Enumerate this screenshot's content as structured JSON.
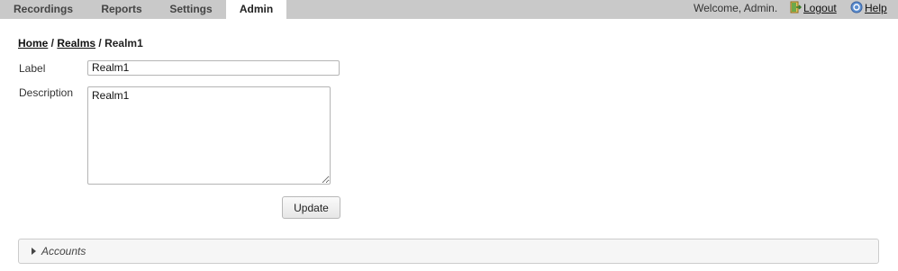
{
  "nav": {
    "tabs": [
      {
        "label": "Recordings"
      },
      {
        "label": "Reports"
      },
      {
        "label": "Settings"
      },
      {
        "label": "Admin",
        "active": true
      }
    ],
    "welcome": "Welcome, Admin.",
    "logout": "Logout",
    "help": "Help"
  },
  "breadcrumb": {
    "home": "Home",
    "sep1": " / ",
    "realms": "Realms",
    "sep2": " / ",
    "current": "Realm1"
  },
  "form": {
    "label_caption": "Label",
    "label_value": "Realm1",
    "description_caption": "Description",
    "description_value": "Realm1",
    "update_label": "Update"
  },
  "accounts": {
    "title": "Accounts"
  },
  "icons": {
    "logout": "logout-door-icon",
    "help": "help-circle-icon",
    "accounts": "triangle-right-icon"
  },
  "colors": {
    "topbar": "#c9c9c9",
    "help_icon": "#4a7fc1",
    "logout_icon": "#5a9a3a"
  }
}
